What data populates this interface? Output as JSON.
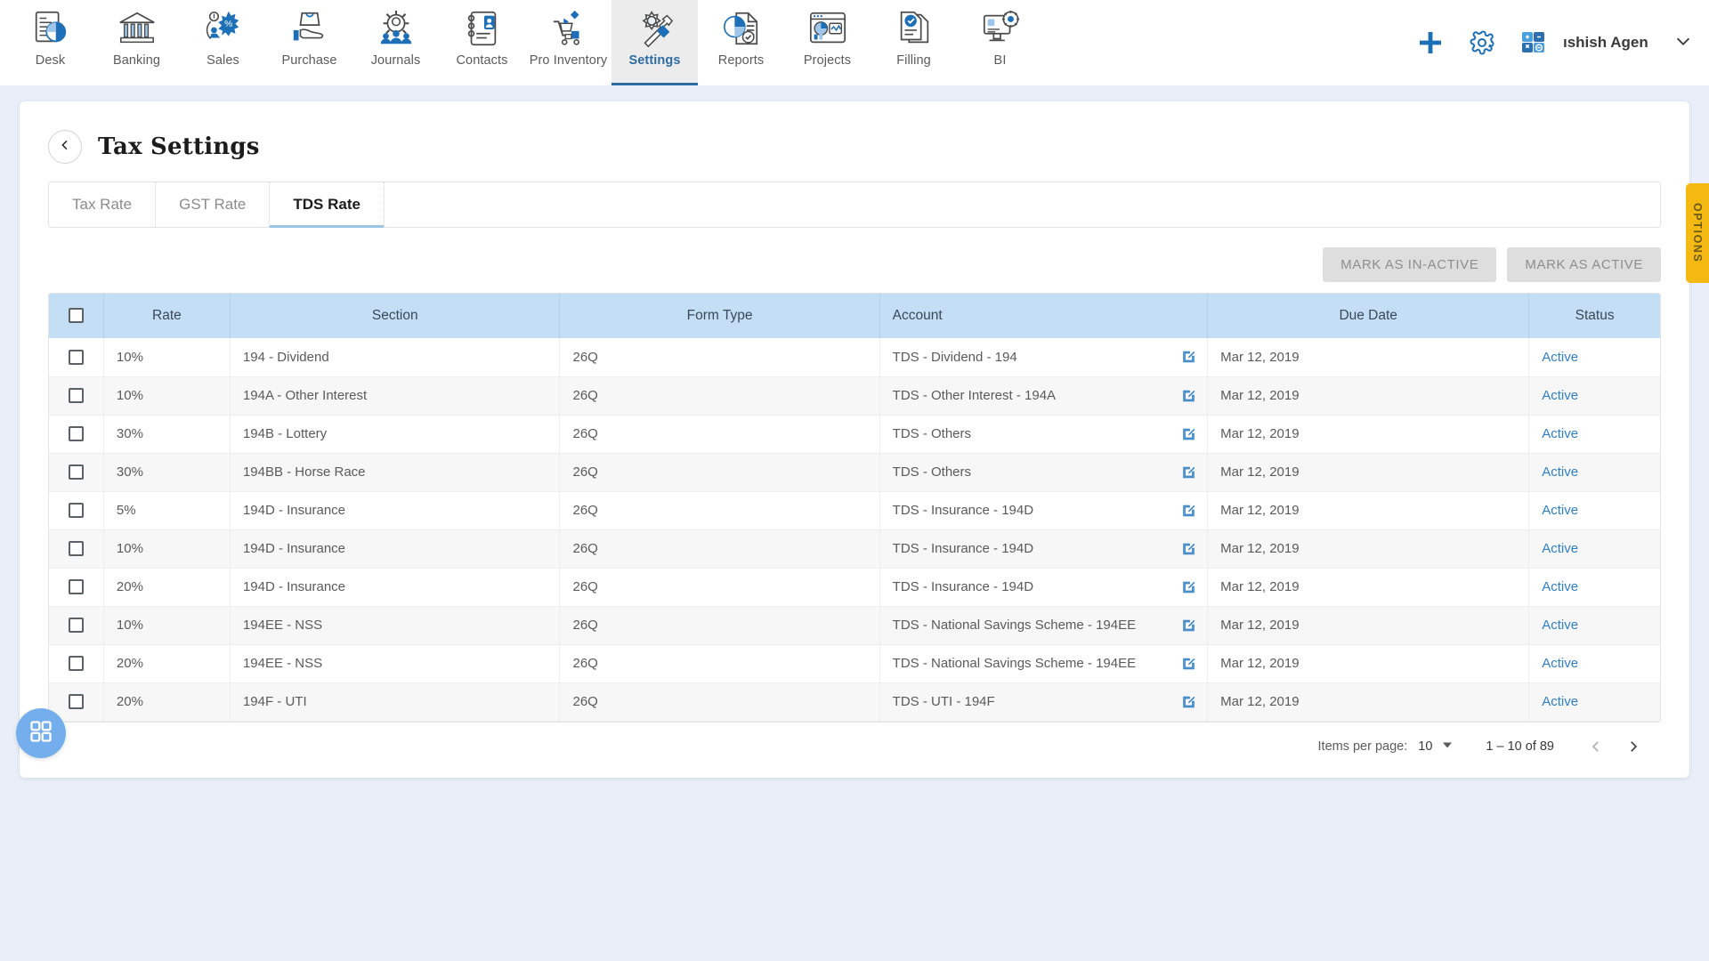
{
  "topnav": {
    "items": [
      {
        "label": "Desk",
        "icon": "desk-icon",
        "active": false
      },
      {
        "label": "Banking",
        "icon": "bank-icon",
        "active": false
      },
      {
        "label": "Sales",
        "icon": "sales-icon",
        "active": false
      },
      {
        "label": "Purchase",
        "icon": "purchase-icon",
        "active": false
      },
      {
        "label": "Journals",
        "icon": "journals-icon",
        "active": false
      },
      {
        "label": "Contacts",
        "icon": "contacts-icon",
        "active": false
      },
      {
        "label": "Pro Inventory",
        "icon": "inventory-icon",
        "active": false
      },
      {
        "label": "Settings",
        "icon": "settings-icon",
        "active": true
      },
      {
        "label": "Reports",
        "icon": "reports-icon",
        "active": false
      },
      {
        "label": "Projects",
        "icon": "projects-icon",
        "active": false
      },
      {
        "label": "Filling",
        "icon": "filling-icon",
        "active": false
      },
      {
        "label": "BI",
        "icon": "bi-icon",
        "active": false
      }
    ],
    "right": {
      "add_icon": "plus-icon",
      "settings_icon": "gear-icon",
      "calculator_icon": "calculator-icon",
      "account_name": "ıshish Agenc",
      "account_caret_icon": "chevron-down-icon"
    }
  },
  "page": {
    "back_icon": "chevron-left-icon",
    "title": "Tax Settings",
    "options_tab_label": "OPTIONS",
    "fab_icon": "grid-apps-icon"
  },
  "tabs": [
    {
      "label": "Tax Rate",
      "active": false
    },
    {
      "label": "GST Rate",
      "active": false
    },
    {
      "label": "TDS Rate",
      "active": true
    }
  ],
  "actions": {
    "mark_inactive_label": "MARK AS IN-ACTIVE",
    "mark_active_label": "MARK AS ACTIVE"
  },
  "table": {
    "select_all_checkbox": false,
    "columns": [
      "",
      "Rate",
      "Section",
      "Form Type",
      "Account",
      "Due Date",
      "Status"
    ],
    "row_edit_icon": "edit-pencil-icon",
    "rows": [
      {
        "checked": false,
        "rate": "10%",
        "section": "194 - Dividend",
        "form_type": "26Q",
        "account": "TDS - Dividend - 194",
        "due_date": "Mar 12, 2019",
        "status": "Active"
      },
      {
        "checked": false,
        "rate": "10%",
        "section": "194A - Other Interest",
        "form_type": "26Q",
        "account": "TDS - Other Interest - 194A",
        "due_date": "Mar 12, 2019",
        "status": "Active"
      },
      {
        "checked": false,
        "rate": "30%",
        "section": "194B - Lottery",
        "form_type": "26Q",
        "account": "TDS - Others",
        "due_date": "Mar 12, 2019",
        "status": "Active"
      },
      {
        "checked": false,
        "rate": "30%",
        "section": "194BB - Horse Race",
        "form_type": "26Q",
        "account": "TDS - Others",
        "due_date": "Mar 12, 2019",
        "status": "Active"
      },
      {
        "checked": false,
        "rate": "5%",
        "section": "194D - Insurance",
        "form_type": "26Q",
        "account": "TDS - Insurance - 194D",
        "due_date": "Mar 12, 2019",
        "status": "Active"
      },
      {
        "checked": false,
        "rate": "10%",
        "section": "194D - Insurance",
        "form_type": "26Q",
        "account": "TDS - Insurance - 194D",
        "due_date": "Mar 12, 2019",
        "status": "Active"
      },
      {
        "checked": false,
        "rate": "20%",
        "section": "194D - Insurance",
        "form_type": "26Q",
        "account": "TDS - Insurance - 194D",
        "due_date": "Mar 12, 2019",
        "status": "Active"
      },
      {
        "checked": false,
        "rate": "10%",
        "section": "194EE - NSS",
        "form_type": "26Q",
        "account": "TDS - National Savings Scheme - 194EE",
        "due_date": "Mar 12, 2019",
        "status": "Active"
      },
      {
        "checked": false,
        "rate": "20%",
        "section": "194EE - NSS",
        "form_type": "26Q",
        "account": "TDS - National Savings Scheme - 194EE",
        "due_date": "Mar 12, 2019",
        "status": "Active"
      },
      {
        "checked": false,
        "rate": "20%",
        "section": "194F - UTI",
        "form_type": "26Q",
        "account": "TDS - UTI - 194F",
        "due_date": "Mar 12, 2019",
        "status": "Active"
      }
    ]
  },
  "paginator": {
    "label": "Items per page:",
    "page_size": "10",
    "caret_icon": "caret-down-icon",
    "range": "1 – 10 of 89",
    "prev_icon": "chevron-left-icon",
    "next_icon": "chevron-right-icon"
  },
  "colors": {
    "accent_blue": "#2f7fc4",
    "table_header_blue": "#c3def5",
    "page_background": "#e9eef8",
    "options_amber": "#f5b914",
    "fab_blue": "#74aeec"
  }
}
